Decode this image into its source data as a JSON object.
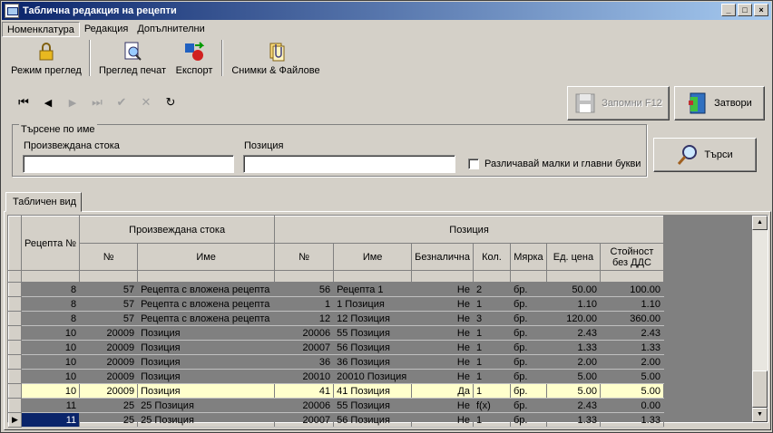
{
  "window": {
    "title": "Таблична редакция на рецепти"
  },
  "menu": [
    {
      "label": "Номенклатура"
    },
    {
      "label": "Редакция"
    },
    {
      "label": "Допълнителни"
    }
  ],
  "toolbar": {
    "view_mode": "Режим преглед",
    "print_preview": "Преглед печат",
    "export": "Експорт",
    "images_files": "Снимки & Файлове"
  },
  "actions": {
    "save": "Запомни F12",
    "close": "Затвори",
    "search": "Търси"
  },
  "search_group": {
    "title": "Търсене по име",
    "product_label": "Произвеждана стока",
    "product_value": "",
    "position_label": "Позиция",
    "position_value": "",
    "case_sensitive_label": "Различавай малки и главни букви",
    "case_sensitive_checked": false
  },
  "tabs": [
    {
      "label": "Табличен вид"
    }
  ],
  "grid": {
    "headers": {
      "recipe_no": "Рецепта №",
      "product_group": "Произвеждана стока",
      "position_group": "Позиция",
      "prod_no": "№",
      "prod_name": "Име",
      "pos_no": "№",
      "pos_name": "Име",
      "cashless": "Безналична",
      "qty": "Кол.",
      "unit": "Мярка",
      "unit_price": "Ед. цена",
      "value_line1": "Стойност",
      "value_line2": "без ДДС"
    },
    "rows": [
      {
        "recipe": "8",
        "prod_no": "57",
        "prod_name": "Рецепта с вложена рецепта",
        "pos_no": "56",
        "pos_name": "Рецепта 1",
        "cashless": "Не",
        "qty": "2",
        "unit": "бр.",
        "price": "50.00",
        "value": "100.00"
      },
      {
        "recipe": "8",
        "prod_no": "57",
        "prod_name": "Рецепта с вложена рецепта",
        "pos_no": "1",
        "pos_name": "1 Позиция",
        "cashless": "Не",
        "qty": "1",
        "unit": "бр.",
        "price": "1.10",
        "value": "1.10"
      },
      {
        "recipe": "8",
        "prod_no": "57",
        "prod_name": "Рецепта с вложена рецепта",
        "pos_no": "12",
        "pos_name": "12 Позиция",
        "cashless": "Не",
        "qty": "3",
        "unit": "бр.",
        "price": "120.00",
        "value": "360.00"
      },
      {
        "recipe": "10",
        "prod_no": "20009",
        "prod_name": "Позиция",
        "pos_no": "20006",
        "pos_name": "55 Позиция",
        "cashless": "Не",
        "qty": "1",
        "unit": "бр.",
        "price": "2.43",
        "value": "2.43"
      },
      {
        "recipe": "10",
        "prod_no": "20009",
        "prod_name": "Позиция",
        "pos_no": "20007",
        "pos_name": "56 Позиция",
        "cashless": "Не",
        "qty": "1",
        "unit": "бр.",
        "price": "1.33",
        "value": "1.33"
      },
      {
        "recipe": "10",
        "prod_no": "20009",
        "prod_name": "Позиция",
        "pos_no": "36",
        "pos_name": "36 Позиция",
        "cashless": "Не",
        "qty": "1",
        "unit": "бр.",
        "price": "2.00",
        "value": "2.00"
      },
      {
        "recipe": "10",
        "prod_no": "20009",
        "prod_name": "Позиция",
        "pos_no": "20010",
        "pos_name": "20010 Позиция",
        "cashless": "Не",
        "qty": "1",
        "unit": "бр.",
        "price": "5.00",
        "value": "5.00"
      },
      {
        "recipe": "10",
        "prod_no": "20009",
        "prod_name": "Позиция",
        "pos_no": "41",
        "pos_name": "41 Позиция",
        "cashless": "Да",
        "qty": "1",
        "unit": "бр.",
        "price": "5.00",
        "value": "5.00"
      },
      {
        "recipe": "11",
        "prod_no": "25",
        "prod_name": "25 Позиция",
        "pos_no": "20006",
        "pos_name": "55 Позиция",
        "cashless": "Не",
        "qty": "f(x)",
        "unit": "бр.",
        "price": "2.43",
        "value": "0.00"
      },
      {
        "recipe": "11",
        "prod_no": "25",
        "prod_name": "25 Позиция",
        "pos_no": "20007",
        "pos_name": "56 Позиция",
        "cashless": "Не",
        "qty": "1",
        "unit": "бр.",
        "price": "1.33",
        "value": "1.33"
      }
    ],
    "highlighted_row": 7,
    "current_row": 9
  },
  "colors": {
    "title_start": "#0a246a",
    "title_end": "#a6caf0",
    "highlight": "#ffffcc",
    "selection": "#0a246a"
  }
}
